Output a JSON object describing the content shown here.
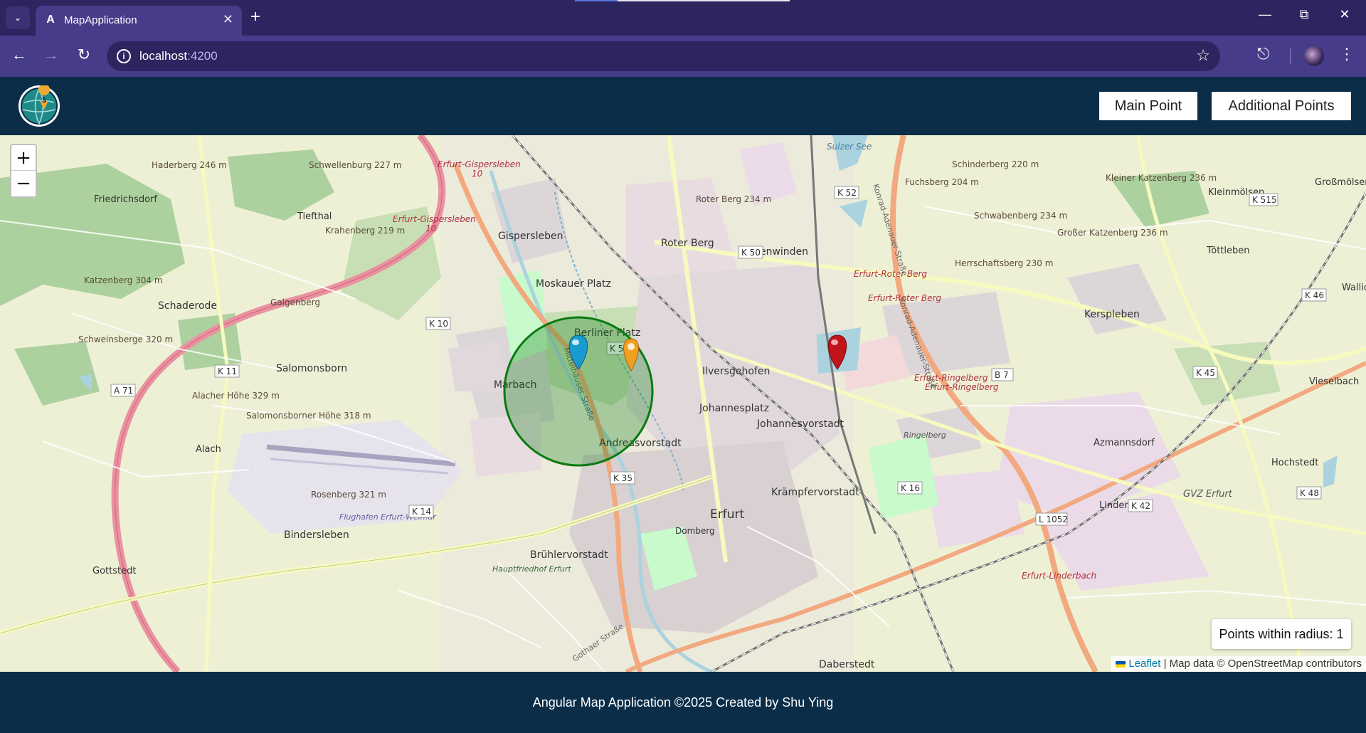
{
  "browser": {
    "tab_title": "MapApplication",
    "tab_favicon_letter": "A",
    "url_host": "localhost",
    "url_port": ":4200"
  },
  "header": {
    "main_point_label": "Main Point",
    "additional_points_label": "Additional Points"
  },
  "map": {
    "zoom_in_label": "+",
    "zoom_out_label": "−",
    "radius_status": "Points within radius: 1",
    "attribution_link": "Leaflet",
    "attribution_text": " | Map data © OpenStreetMap contributors",
    "markers": [
      {
        "color": "#1a9bd0",
        "role": "main-point"
      },
      {
        "color": "#f0a020",
        "role": "additional-point"
      },
      {
        "color": "#c0151b",
        "role": "additional-point"
      }
    ],
    "circle_color": "#0a7a12",
    "places": {
      "gispersleben": "Gispersleben",
      "roter_berg": "Roter Berg",
      "hohenwinden": "Hohenwinden",
      "moskauer_platz": "Moskauer Platz",
      "berliner_platz": "Berliner Platz",
      "ilversgehofen": "Ilversgehofen",
      "johannesplatz": "Johannesplatz",
      "johannesvorstadt": "Johannesvorstadt",
      "andreasvorstadt": "Andreasvorstadt",
      "marbach": "Marbach",
      "kraempfervorstadt": "Krämpfervorstadt",
      "erfurt": "Erfurt",
      "bruehlervorstadt": "Brühlervorstadt",
      "daberstedt": "Daberstedt",
      "domberg": "Domberg",
      "bindersleben": "Bindersleben",
      "gottstedt": "Gottstedt",
      "alach": "Alach",
      "salomonsborn": "Salomonsborn",
      "schaderode": "Schaderode",
      "tiefthal": "Tiefthal",
      "friedrichsdorf": "Friedrichsdorf",
      "kerspleben": "Kerspleben",
      "toettleben": "Töttleben",
      "azmannsdorf": "Azmannsdorf",
      "linderbach": "Linderbach",
      "vieselbach": "Vieselbach",
      "kleinmoelsen": "Kleinmölsen",
      "grossmoelsen": "Großmölsen",
      "hochstedt": "Hochstedt",
      "gvz_erfurt": "GVZ Erfurt",
      "ringelberg": "Ringelberg",
      "flughafen": "Flughafen Erfurt-Weimar",
      "hauptfriedhof": "Hauptfriedhof Erfurt",
      "wallic": "Wallic"
    },
    "hills": {
      "haderberg": "Haderberg 246 m",
      "schwellenburg": "Schwellenburg 227 m",
      "krahenberg": "Krahenberg 219 m",
      "katzenberg": "Katzenberg 304 m",
      "galgenberg": "Galgenberg",
      "schweinsberge": "Schweinsberge 320 m",
      "alacher_hoehe": "Alacher Höhe 329 m",
      "salomonsborner_hoehe": "Salomonsborner Höhe 318 m",
      "rosenberg": "Rosenberg 321 m",
      "roter_berg_h": "Roter Berg 234 m",
      "schinderberg": "Schinderberg 220 m",
      "fuchsberg": "Fuchsberg 204 m",
      "schwabenberg": "Schwabenberg 234 m",
      "kleiner_katzenberg": "Kleiner Katzenberg 236 m",
      "grosser_katzenberg": "Großer Katzenberg 236 m",
      "herrschaftsberg": "Herrschaftsberg 230 m",
      "sulzer_see": "Sulzer See"
    },
    "roads": {
      "k52": "K 52",
      "k50": "K 50",
      "k10": "K 10",
      "k56": "K 56",
      "k11": "K 11",
      "a71": "A 71",
      "k35": "K 35",
      "k14": "K 14",
      "k16": "K 16",
      "l1052": "L 1052",
      "k42": "K 42",
      "k48": "K 48",
      "k45": "K 45",
      "k46": "K 46",
      "k515": "K 515",
      "b7": "B 7",
      "erfurt_gispersleben_1": "Erfurt-Gispersleben",
      "exit_10": "10",
      "erfurt_roter_berg": "Erfurt-Roter Berg",
      "erfurt_ringelberg": "Erfurt-Ringelberg",
      "erfurt_linderbach": "Erfurt-Linderbach",
      "mittelhaeuser": "Mittelhäuser Straße",
      "konrad_adenauer": "Konrad-Adenauer-Straße",
      "gothaer": "Gothaer Straße"
    }
  },
  "footer": {
    "text": "Angular Map Application ©2025 Created by Shu Ying"
  }
}
